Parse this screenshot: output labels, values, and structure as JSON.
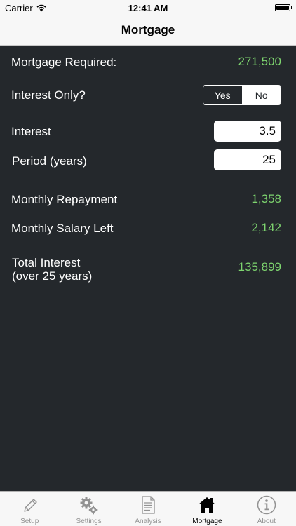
{
  "status_bar": {
    "carrier": "Carrier",
    "time": "12:41 AM"
  },
  "nav": {
    "title": "Mortgage"
  },
  "form": {
    "mortgage_required": {
      "label": "Mortgage Required:",
      "value": "271,500"
    },
    "interest_only": {
      "label": "Interest Only?",
      "options": [
        "Yes",
        "No"
      ],
      "selected": "No"
    },
    "interest": {
      "label": "Interest",
      "value": "3.5"
    },
    "period": {
      "label": "Period (years)",
      "value": "25"
    },
    "monthly_repayment": {
      "label": "Monthly Repayment",
      "value": "1,358"
    },
    "monthly_salary_left": {
      "label": "Monthly Salary Left",
      "value": "2,142"
    },
    "total_interest": {
      "label_line1": "Total Interest",
      "label_line2": "(over 25 years)",
      "value": "135,899"
    }
  },
  "tabs": [
    {
      "label": "Setup",
      "icon": "pencil-icon",
      "active": false
    },
    {
      "label": "Settings",
      "icon": "gears-icon",
      "active": false
    },
    {
      "label": "Analysis",
      "icon": "document-icon",
      "active": false
    },
    {
      "label": "Mortgage",
      "icon": "house-icon",
      "active": true
    },
    {
      "label": "About",
      "icon": "info-icon",
      "active": false
    }
  ],
  "colors": {
    "background": "#24282c",
    "value_green": "#7ed56f",
    "tab_inactive": "#929292",
    "tab_active": "#000000"
  }
}
